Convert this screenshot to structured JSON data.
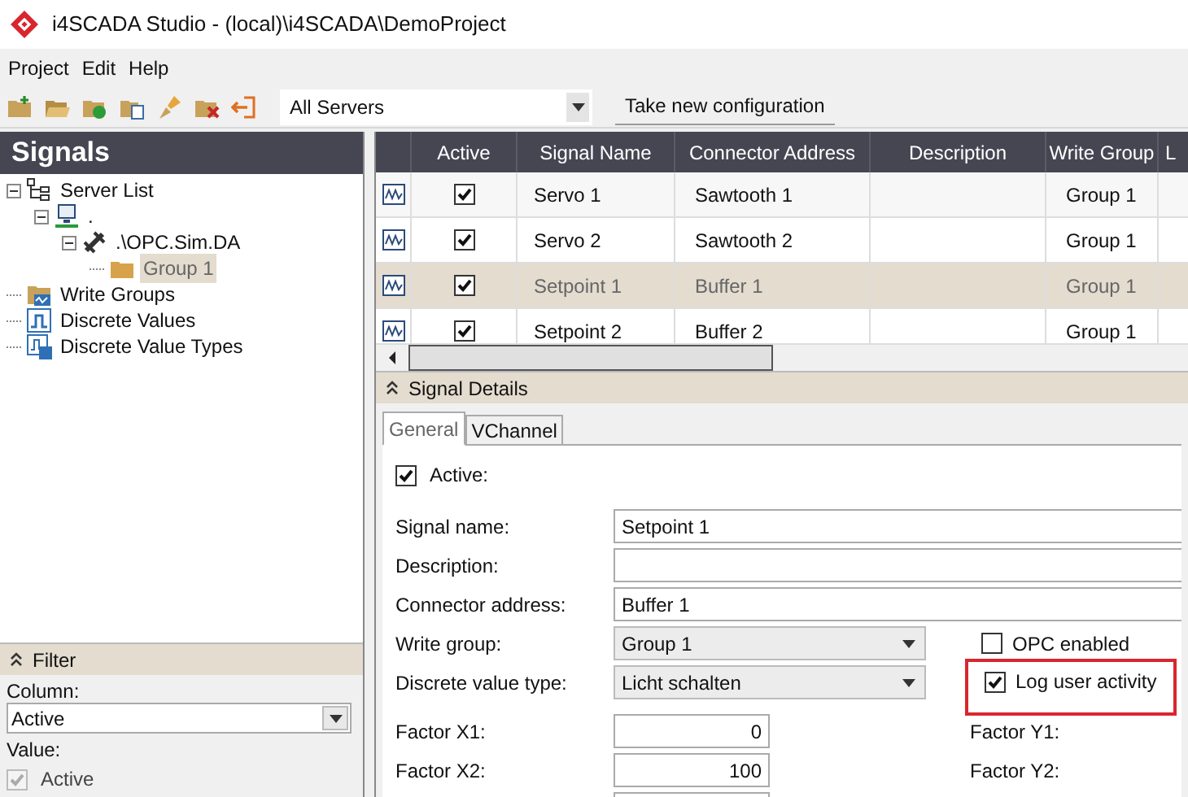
{
  "window": {
    "title": "i4SCADA Studio - (local)\\i4SCADA\\DemoProject"
  },
  "menu": [
    {
      "label": "Project"
    },
    {
      "label": "Edit"
    },
    {
      "label": "Help"
    }
  ],
  "toolbar": {
    "server_select": {
      "value": "All Servers"
    },
    "take_config": {
      "label": "Take new configuration"
    }
  },
  "signals_panel": {
    "title": "Signals",
    "tree": [
      {
        "label": "Server List",
        "kind": "server-list",
        "selected": false,
        "expanded": true,
        "children": [
          {
            "label": ".",
            "kind": "server",
            "selected": false,
            "expanded": true,
            "children": [
              {
                "label": ".\\OPC.Sim.DA",
                "kind": "connector",
                "selected": false,
                "expanded": true,
                "children": [
                  {
                    "label": "Group 1",
                    "kind": "folder",
                    "selected": true
                  }
                ]
              }
            ]
          }
        ]
      },
      {
        "label": "Write Groups",
        "kind": "write-groups",
        "selected": false
      },
      {
        "label": "Discrete Values",
        "kind": "discrete-values",
        "selected": false
      },
      {
        "label": "Discrete Value Types",
        "kind": "discrete-value-types",
        "selected": false
      }
    ],
    "filter": {
      "title": "Filter",
      "column_label": "Column:",
      "column_value": "Active",
      "value_label": "Value:",
      "value_checkbox": {
        "label": "Active",
        "checked": true,
        "disabled": true
      }
    }
  },
  "grid": {
    "columns": [
      "Active",
      "Signal Name",
      "Connector Address",
      "Description",
      "Write Group",
      "L"
    ],
    "rows": [
      {
        "active": true,
        "signal_name": "Servo 1",
        "connector_address": "Sawtooth 1",
        "write_group": "Group 1",
        "selected": false
      },
      {
        "active": true,
        "signal_name": "Servo 2",
        "connector_address": "Sawtooth 2",
        "write_group": "Group 1",
        "selected": false
      },
      {
        "active": true,
        "signal_name": "Setpoint 1",
        "connector_address": "Buffer 1",
        "write_group": "Group 1",
        "selected": true
      },
      {
        "active": true,
        "signal_name": "Setpoint 2",
        "connector_address": "Buffer 2",
        "write_group": "Group 1",
        "selected": false
      }
    ]
  },
  "details": {
    "title": "Signal Details",
    "tabs": [
      {
        "label": "General",
        "selected": true
      },
      {
        "label": "VChannel",
        "selected": false
      }
    ],
    "active_checkbox": {
      "label": "Active:",
      "checked": true
    },
    "fields": [
      {
        "label": "Signal name:",
        "value": "Setpoint 1",
        "kind": "text"
      },
      {
        "label": "Description:",
        "kind": "text"
      },
      {
        "label": "Connector address:",
        "value": "Buffer 1",
        "kind": "text"
      },
      {
        "label": "Write group:",
        "value": "Group 1",
        "kind": "select"
      },
      {
        "label": "Discrete value type:",
        "value": "Licht schalten",
        "kind": "select"
      }
    ],
    "options": [
      {
        "label": "OPC enabled",
        "checked": false,
        "highlighted": false
      },
      {
        "label": "Log user activity",
        "checked": true,
        "highlighted": true
      }
    ],
    "factors": [
      {
        "label": "Factor X1:",
        "value": "0"
      },
      {
        "label": "Factor X2:",
        "value": "100"
      }
    ],
    "factor_y_labels": [
      {
        "label": "Factor Y1:"
      },
      {
        "label": "Factor Y2:"
      }
    ]
  }
}
